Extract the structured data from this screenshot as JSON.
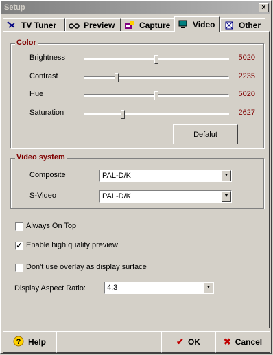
{
  "window": {
    "title": "Setup",
    "close_label": "×"
  },
  "tabs": [
    {
      "label": "TV Tuner",
      "icon": "tv-tuner-icon"
    },
    {
      "label": "Preview",
      "icon": "glasses-icon"
    },
    {
      "label": "Capture",
      "icon": "capture-icon"
    },
    {
      "label": "Video",
      "icon": "monitor-icon",
      "active": true
    },
    {
      "label": "Other",
      "icon": "other-icon"
    }
  ],
  "color": {
    "title": "Color",
    "sliders": [
      {
        "label": "Brightness",
        "value": "5020",
        "level": 0.5
      },
      {
        "label": "Contrast",
        "value": "2235",
        "level": 0.22
      },
      {
        "label": "Hue",
        "value": "5020",
        "level": 0.5
      },
      {
        "label": "Saturation",
        "value": "2627",
        "level": 0.26
      }
    ],
    "default_button": "Defalut"
  },
  "video_system": {
    "title": "Video system",
    "composite_label": "Composite",
    "composite_value": "PAL-D/K",
    "svideo_label": "S-Video",
    "svideo_value": "PAL-D/K"
  },
  "options": [
    {
      "label": "Always On Top",
      "checked": false
    },
    {
      "label": "Enable high quality preview",
      "checked": true
    },
    {
      "label": "Don't use overlay as display surface",
      "checked": false
    }
  ],
  "aspect": {
    "label": "Display Aspect Ratio:",
    "value": "4:3"
  },
  "bottom": {
    "help": "Help",
    "ok": "OK",
    "cancel": "Cancel"
  },
  "colors": {
    "group_title": "#800000",
    "value_text": "#800000",
    "ok_icon": "#c00000",
    "cancel_icon": "#c00000"
  }
}
